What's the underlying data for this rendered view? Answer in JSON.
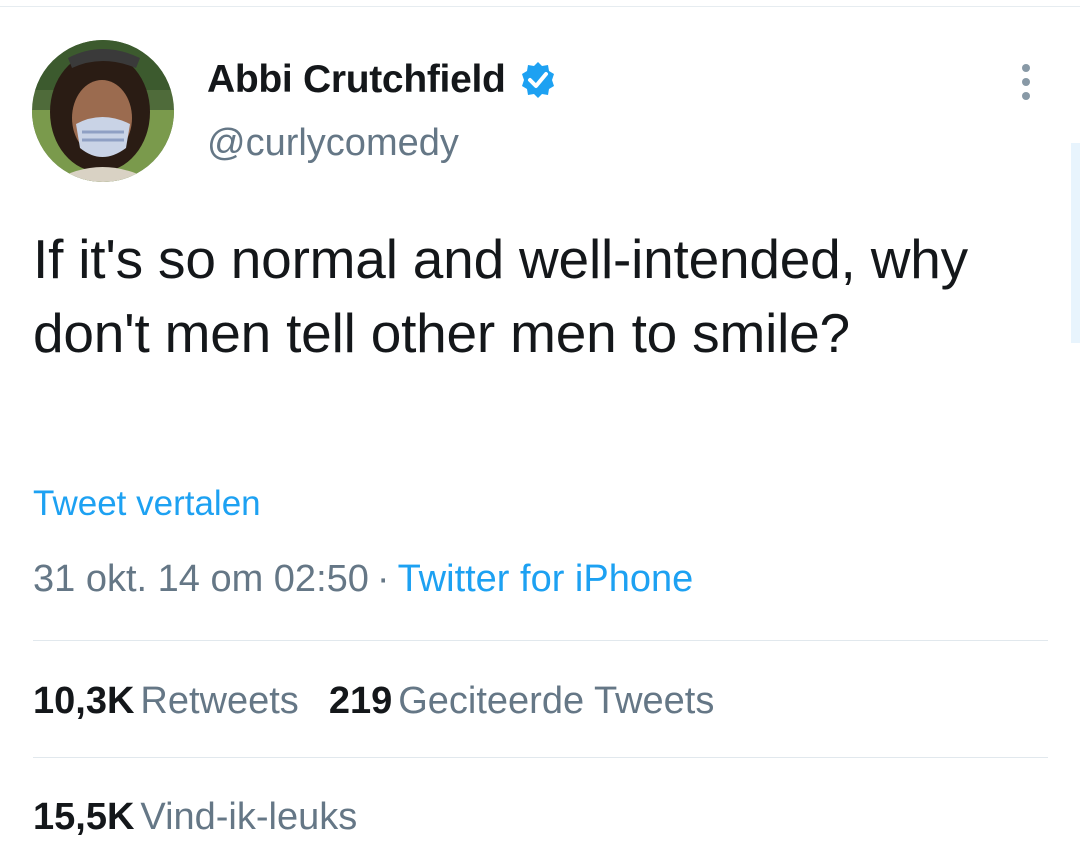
{
  "tweet": {
    "author": {
      "display_name": "Abbi Crutchfield",
      "handle": "@curlycomedy",
      "verified": true
    },
    "text": "If it's so normal and well-intended, why don't men tell other men to smile?",
    "translate_label": "Tweet vertalen",
    "timestamp": "31 okt. 14 om 02:50",
    "separator": "·",
    "source": "Twitter for iPhone",
    "stats": {
      "retweets_count": "10,3K",
      "retweets_label": "Retweets",
      "quotes_count": "219",
      "quotes_label": "Geciteerde Tweets",
      "likes_count": "15,5K",
      "likes_label": "Vind-ik-leuks"
    }
  },
  "icons": {
    "verified": "verified-badge-icon",
    "more": "more-options-icon"
  },
  "colors": {
    "accent": "#1da1f2",
    "text_primary": "#14171a",
    "text_secondary": "#657786",
    "divider": "#e1e8ed"
  }
}
